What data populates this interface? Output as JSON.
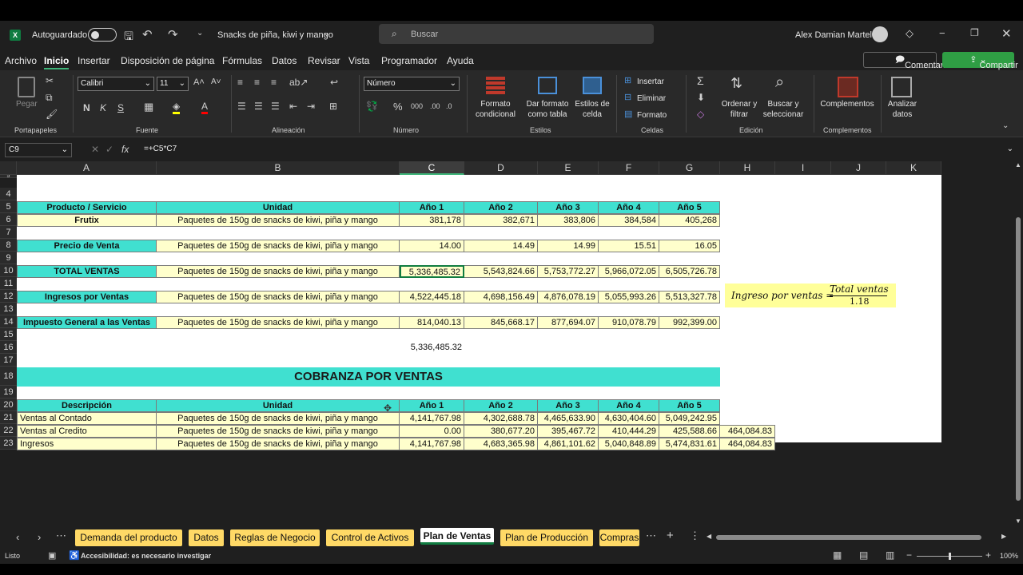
{
  "app": {
    "autosave": "Autoguardado",
    "filename": "Snacks de piña, kiwi y mango",
    "search_placeholder": "Buscar",
    "user": "Alex Damian Martel"
  },
  "menu": [
    "Archivo",
    "Inicio",
    "Insertar",
    "Disposición de página",
    "Fórmulas",
    "Datos",
    "Revisar",
    "Vista",
    "Programador",
    "Ayuda"
  ],
  "menu_active": "Inicio",
  "comments_label": "Comentarios",
  "share_label": "Compartir",
  "ribbon": {
    "paste": "Pegar",
    "clipboard": "Portapapeles",
    "font_name": "Calibri",
    "font_size": "11",
    "font": "Fuente",
    "alignment": "Alineación",
    "number_format": "Número",
    "number": "Número",
    "cond_format": "Formato condicional",
    "table_format": "Dar formato como tabla",
    "cell_styles": "Estilos de celda",
    "styles": "Estilos",
    "insert": "Insertar",
    "delete": "Eliminar",
    "format": "Formato",
    "cells": "Celdas",
    "sort": "Ordenar y filtrar",
    "find": "Buscar y seleccionar",
    "editing": "Edición",
    "addins": "Complementos",
    "addins_group": "Complementos",
    "analyze": "Analizar datos"
  },
  "formula_bar": {
    "name_box": "C9",
    "formula": "=+C5*C7"
  },
  "columns": [
    "A",
    "B",
    "C",
    "D",
    "E",
    "F",
    "G",
    "H",
    "I",
    "J",
    "K"
  ],
  "rows": [
    "5",
    "4",
    "5",
    "6",
    "7",
    "8",
    "9",
    "10",
    "11",
    "12",
    "13",
    "14",
    "15",
    "16",
    "17",
    "18",
    "19",
    "20",
    "21",
    "22",
    "23"
  ],
  "sheet": {
    "header_row": [
      "Producto / Servicio",
      "Unidad",
      "Año 1",
      "Año 2",
      "Año 3",
      "Año 4",
      "Año 5"
    ],
    "frutix": {
      "label": "Frutix",
      "unit": "Paquetes de 150g de snacks de kiwi, piña y mango",
      "values": [
        "381,178",
        "382,671",
        "383,806",
        "384,584",
        "405,268"
      ]
    },
    "precio": {
      "label": "Precio de Venta",
      "unit": "Paquetes de 150g de snacks de kiwi, piña y mango",
      "values": [
        "14.00",
        "14.49",
        "14.99",
        "15.51",
        "16.05"
      ]
    },
    "total": {
      "label": "TOTAL VENTAS",
      "unit": "Paquetes de 150g de snacks de kiwi, piña y mango",
      "values": [
        "5,336,485.32",
        "5,543,824.66",
        "5,753,772.27",
        "5,966,072.05",
        "6,505,726.78"
      ]
    },
    "ingresos": {
      "label": "Ingresos por Ventas",
      "unit": "Paquetes de 150g de snacks de kiwi, piña y mango",
      "values": [
        "4,522,445.18",
        "4,698,156.49",
        "4,876,078.19",
        "5,055,993.26",
        "5,513,327.78"
      ]
    },
    "igv": {
      "label": "Impuesto General a las Ventas",
      "unit": "Paquetes de 150g de snacks de kiwi, piña y mango",
      "values": [
        "814,040.13",
        "845,668.17",
        "877,694.07",
        "910,078.79",
        "992,399.00"
      ]
    },
    "c15": "5,336,485.32",
    "formula_note": {
      "lhs": "Ingreso por ventas =",
      "num": "Total ventas",
      "den": "1.18"
    },
    "cobranza_title": "COBRANZA POR VENTAS",
    "cob_header": [
      "Descripción",
      "Unidad",
      "Año 1",
      "Año 2",
      "Año 3",
      "Año 4",
      "Año 5"
    ],
    "contado": {
      "label": "Ventas al Contado",
      "unit": "Paquetes de 150g de snacks de kiwi, piña y mango",
      "values": [
        "4,141,767.98",
        "4,302,688.78",
        "4,465,633.90",
        "4,630,404.60",
        "5,049,242.95"
      ]
    },
    "credito": {
      "label": "Ventas al Credito",
      "unit": "Paquetes de 150g de snacks de kiwi, piña y mango",
      "values": [
        "0.00",
        "380,677.20",
        "395,467.72",
        "410,444.29",
        "425,588.66"
      ],
      "h": "464,084.83"
    },
    "ingr2": {
      "label": "Ingresos",
      "unit": "Paquetes de 150g de snacks de kiwi, piña y mango",
      "values": [
        "4,141,767.98",
        "4,683,365.98",
        "4,861,101.62",
        "5,040,848.89",
        "5,474,831.61"
      ],
      "h": "464,084.83"
    }
  },
  "tabs": [
    "Demanda del producto",
    "Datos",
    "Reglas de Negocio",
    "Control de Activos",
    "Plan de Ventas",
    "Plan de Producción",
    "Compras"
  ],
  "active_tab": "Plan de Ventas",
  "status": {
    "ready": "Listo",
    "accessibility": "Accesibilidad: es necesario investigar",
    "zoom": "100%"
  },
  "colors": {
    "header_fill": "#40e0d0",
    "input_fill": "#ffffcc",
    "tab_fill": "#ffd966",
    "share": "#2f9e44"
  }
}
